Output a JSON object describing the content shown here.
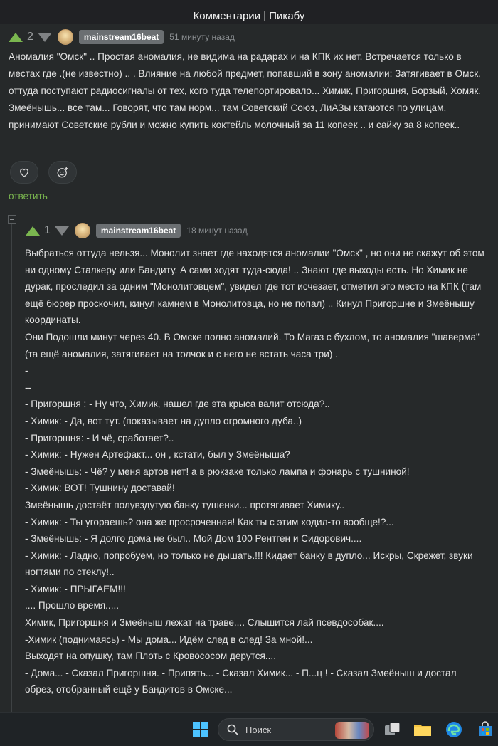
{
  "window": {
    "title": "Комментарии | Пикабу"
  },
  "comment1": {
    "rating": "2",
    "author": "mainstream16beat",
    "time": "51 минуту назад",
    "text": "Аномалия \"Омск\" .. Простая аномалия, не видима на радарах и на КПК их нет. Встречается только в местах где .(не известно) .. . Влияние на любой предмет, попавший в зону аномалии: Затягивает в Омск, оттуда поступают радиосигналы от тех, кого туда телепортировало... Химик, Пригоршня, Борзый, Хомяк, Змеёнышь... все там... Говорят, что там норм... там Советский Союз, ЛиАЗы катаются по улицам, принимают Советские рубли и можно купить коктейль молочный за 11 копеек .. и сайку за 8 копеек..",
    "reply_label": "ответить"
  },
  "comment2": {
    "rating": "1",
    "author": "mainstream16beat",
    "time": "18 минут назад",
    "lines": [
      "Выбраться оттуда нельзя... Монолит знает где находятся аномалии \"Омск\" , но они не скажут об этом ни одному Сталкеру или Бандиту. А сами ходят туда-сюда! .. Знают где выходы есть. Но Химик не дурак, проследил за одним \"Монолитовцем\", увидел где тот исчезает, отметил это место на КПК (там ещё бюрер проскочил, кинул камнем в Монолитовца, но не попал) .. Кинул Пригоршне и Змеёнышу координаты.",
      "Они Подошли минут через 40. В Омске полно аномалий. То Магаз с бухлом, то аномалия \"шаверма\" (та ещё аномалия, затягивает на толчок и с него не встать часа три) .",
      "-",
      "--",
      "- Пригоршня : - Ну что, Химик, нашел где эта крыса валит отсюда?..",
      "- Химик: - Да, вот тут. (показывает на дупло огромного дуба..)",
      "- Пригоршня: - И чё, сработает?..",
      "- Химик: - Нужен Артефакт... он , кстати, был у Змеёныша?",
      "- Змеёнышь: - Чё? у меня артов нет! а в рюкзаке только лампа и фонарь с тушниной!",
      "- Химик: ВОТ! Тушнину доставай!",
      "Змеёнышь достаёт полувздутую банку тушенки... протягивает Химику..",
      "- Химик: - Ты угораешь? она же просроченная! Как ты с этим ходил-то вообще!?...",
      "- Змеёнышь: - Я долго дома не был.. Мой Дом 100 Рентген и Сидорович....",
      "- Химик: - Ладно, попробуем, но только не дышать.!!! Кидает банку в дупло... Искры, Скрежет, звуки ногтями по стеклу!..",
      "- Химик: - ПРЫГАЕМ!!!",
      ".... Прошло время.....",
      "Химик, Пригоршня и Змеёныш лежат на траве.... Слышится лай псевдособак....",
      "-Химик (поднимаясь) - Мы дома... Идём след в след! За мной!...",
      "Выходят на опушку, там Плоть с Кровососом дерутся....",
      "- Дома... - Сказал Пригоршня. - Припять... - Сказал Химик... - П...ц ! - Сказал Змеёныш и достал обрез, отобранный ещё у Бандитов в Омске..."
    ]
  },
  "taskbar": {
    "search_label": "Поиск"
  },
  "colors": {
    "accent": "#7ab64f",
    "badge": "#6b6f72",
    "bg": "#26292a"
  }
}
